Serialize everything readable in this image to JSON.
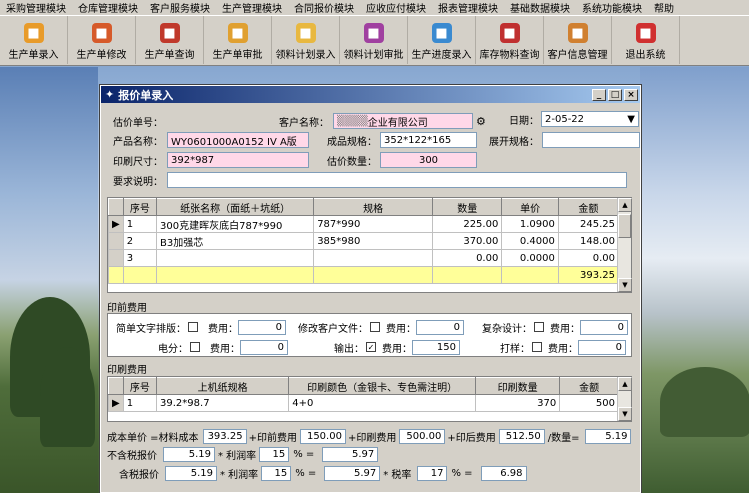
{
  "menu": [
    "采购管理模块",
    "仓库管理模块",
    "客户服务模块",
    "生产管理模块",
    "合同报价模块",
    "应收应付模块",
    "报表管理模块",
    "基础数据模块",
    "系统功能模块",
    "帮助"
  ],
  "toolbar": [
    {
      "label": "生产单录入",
      "icon": "order-entry-icon",
      "color": "#e89b2a"
    },
    {
      "label": "生产单修改",
      "icon": "order-edit-icon",
      "color": "#d65a2a"
    },
    {
      "label": "生产单查询",
      "icon": "order-query-icon",
      "color": "#c0392b"
    },
    {
      "label": "生产单审批",
      "icon": "order-approve-icon",
      "color": "#e0a030"
    },
    {
      "label": "领料计划录入",
      "icon": "material-plan-icon",
      "color": "#e8b840"
    },
    {
      "label": "领料计划审批",
      "icon": "material-approve-icon",
      "color": "#a040a0"
    },
    {
      "label": "生产进度录入",
      "icon": "progress-icon",
      "color": "#3a8ad0"
    },
    {
      "label": "库存物料查询",
      "icon": "inventory-icon",
      "color": "#c03030"
    },
    {
      "label": "客户信息管理",
      "icon": "customer-icon",
      "color": "#d08030"
    },
    {
      "label": "退出系统",
      "icon": "exit-icon",
      "color": "#d03030"
    }
  ],
  "dialog": {
    "title": "报价单录入",
    "quote_no_label": "估价单号：",
    "customer_label": "客户名称：",
    "customer_value": "企业有限公司",
    "date_label": "日期：",
    "date_value": "2-05-22",
    "product_label": "产品名称：",
    "product_value": "WY0601000A0152  IV  A版",
    "spec_label": "成品规格：",
    "spec_value": "352*122*165",
    "unfold_label": "展开规格：",
    "print_size_label": "印刷尺寸：",
    "print_size_value": "392*987",
    "qty_label": "估价数量：",
    "qty_value": "300",
    "req_label": "要求说明："
  },
  "paper_table": {
    "headers": [
      "序号",
      "纸张名称（面纸＋坑纸）",
      "规格",
      "数量",
      "单价",
      "金额"
    ],
    "rows": [
      [
        "1",
        "300克建晖灰底白787*990",
        "787*990",
        "225.00",
        "1.0900",
        "245.25"
      ],
      [
        "2",
        "B3加强芯",
        "385*980",
        "370.00",
        "0.4000",
        "148.00"
      ],
      [
        "3",
        "",
        "",
        "0.00",
        "0.0000",
        "0.00"
      ]
    ],
    "total": "393.25"
  },
  "prepress": {
    "title": "印前费用",
    "simple_type": "简单文字排版：",
    "fee": "费用：",
    "fee1": "0",
    "modify_file": "修改客户文件：",
    "fee2": "0",
    "complex": "复杂设计：",
    "fee3": "0",
    "electro": "电分：",
    "fee4": "0",
    "output": "输出：",
    "fee5": "150",
    "proof": "打样：",
    "fee6": "0"
  },
  "print_fee": {
    "title": "印刷费用",
    "headers": [
      "序号",
      "上机纸规格",
      "印刷颜色（金银卡、专色需注明）",
      "印刷数量",
      "金额"
    ],
    "rows": [
      [
        "1",
        "39.2*98.7",
        "4+0",
        "370",
        "500"
      ]
    ]
  },
  "footer": {
    "cost_label": "成本单价 =材料成本",
    "material_cost": "393.25",
    "plus_prepress": "+印前费用",
    "prepress_cost": "150.00",
    "plus_print": "+印刷费用",
    "print_cost": "500.00",
    "plus_post": "+印后费用",
    "post_cost": "512.50",
    "div_qty": "/数量=",
    "unit_cost": "5.19",
    "notax_label": "不含税报价",
    "notax_base": "5.19",
    "profit_label": "* 利润率",
    "notax_rate": "15",
    "pct_eq": "%  =",
    "notax_result": "5.97",
    "tax_label": "含税报价",
    "tax_base": "5.19",
    "tax_rate": "15",
    "tax_mid": "5.97",
    "taxrate_label": "* 税率",
    "tax_pct": "17",
    "tax_result": "6.98"
  }
}
